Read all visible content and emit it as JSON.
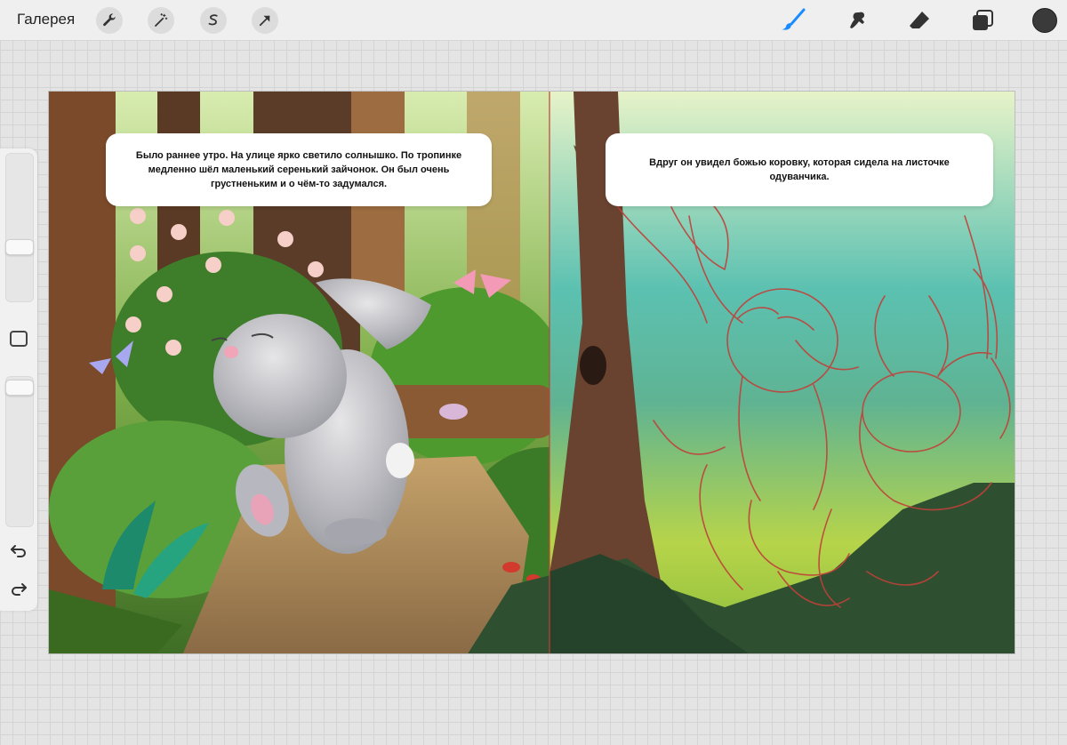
{
  "toolbar": {
    "gallery_label": "Галерея",
    "left_tools": [
      {
        "name": "wrench-icon"
      },
      {
        "name": "magic-wand-icon"
      },
      {
        "name": "selection-icon"
      },
      {
        "name": "transform-arrow-icon"
      }
    ],
    "right_tools": [
      {
        "name": "brush-icon",
        "active_color": "#1a8cff"
      },
      {
        "name": "smudge-icon"
      },
      {
        "name": "eraser-icon"
      },
      {
        "name": "layers-icon"
      }
    ],
    "current_color": "#3a3a3a"
  },
  "sidebar": {
    "brush_size_level": 0.65,
    "opacity_level": 0.95,
    "modify_icon": "square-icon",
    "undo_icon": "undo-icon",
    "redo_icon": "redo-icon"
  },
  "canvas": {
    "left_page_text": "Было раннее утро. На улице ярко светило солнышко. По тропинке медленно шёл маленький серенький зайчонок. Он был очень грустненьким и о чём-то задумался.",
    "right_page_text": "Вдруг он увидел божью коровку, которая сидела на листочке одуванчика.",
    "sketch_color": "#c0413a"
  }
}
